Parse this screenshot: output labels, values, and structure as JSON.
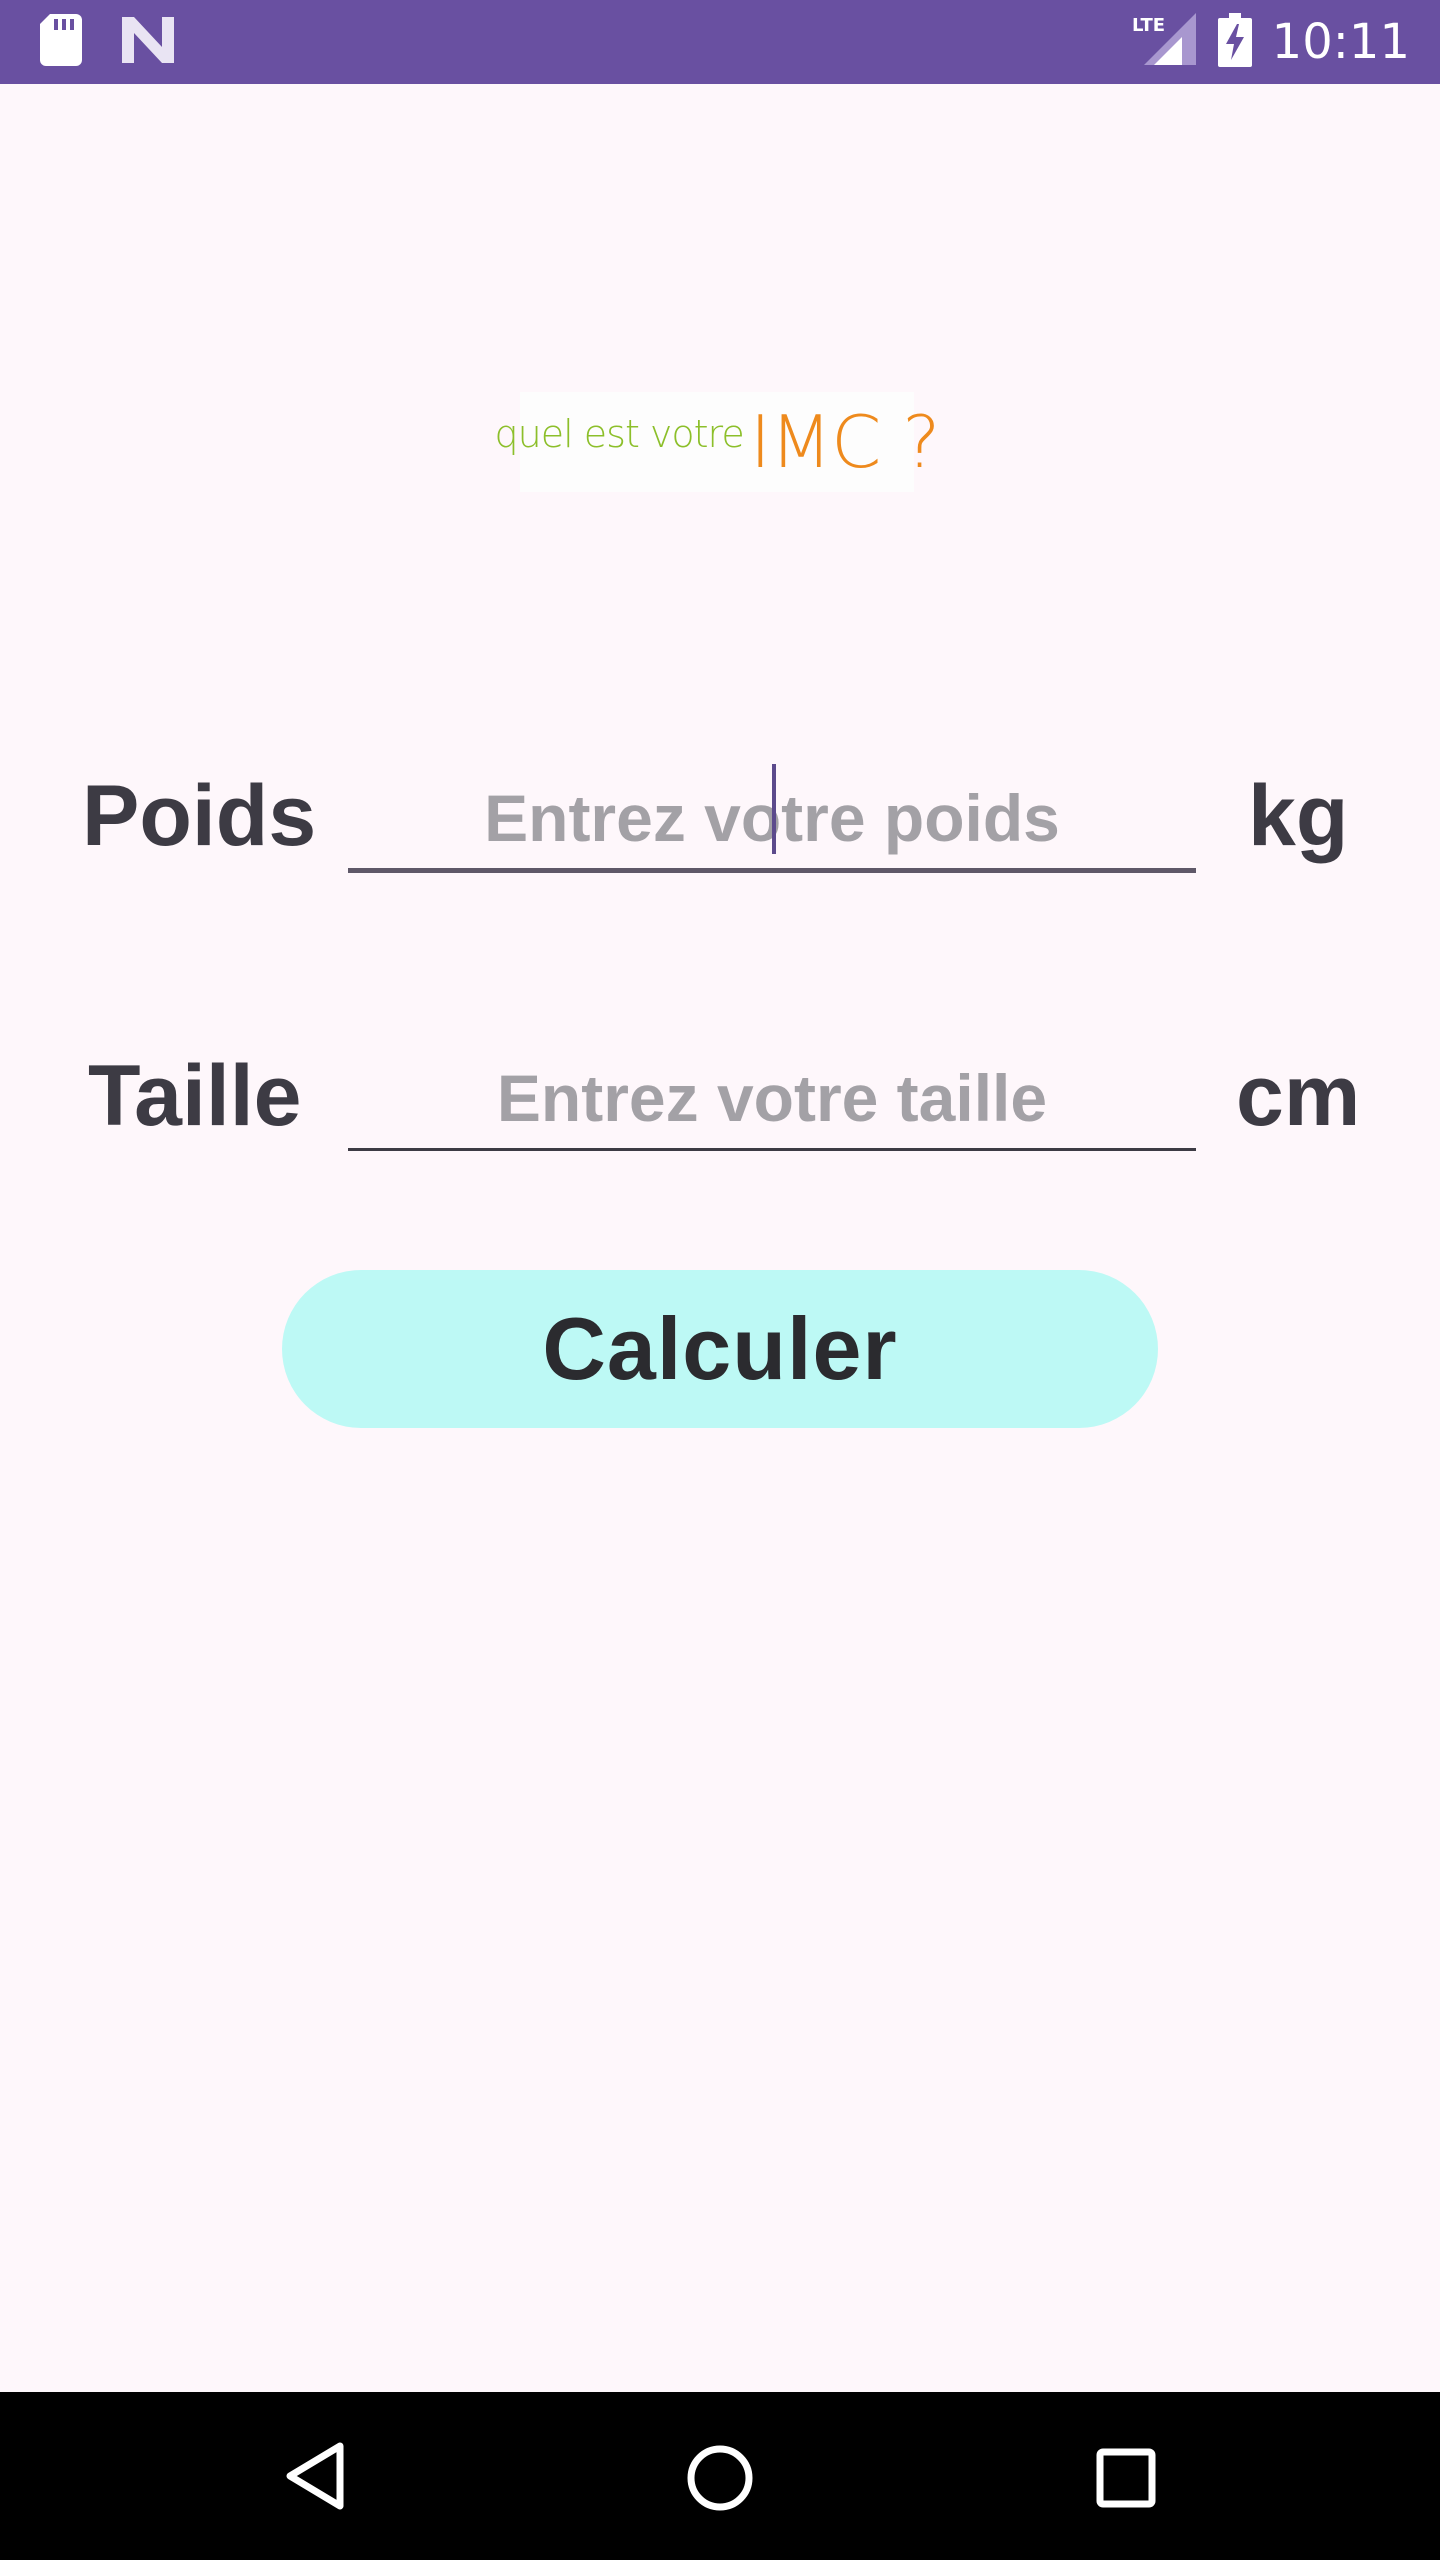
{
  "status_bar": {
    "time": "10:11",
    "network": "LTE",
    "background_color": "#6950a1",
    "icons": [
      "sd-card-icon",
      "n-logo-icon",
      "lte-signal-icon",
      "battery-charging-icon"
    ]
  },
  "logo": {
    "small_text": "quel est votre",
    "big_text": "IMC ?"
  },
  "form": {
    "weight": {
      "label": "Poids",
      "placeholder": "Entrez votre poids",
      "value": "",
      "unit": "kg",
      "focused": true
    },
    "height": {
      "label": "Taille",
      "placeholder": "Entrez votre taille",
      "value": "",
      "unit": "cm"
    },
    "submit_label": "Calculer",
    "button_color": "#bdf9f5"
  },
  "nav_bar": {
    "icons": [
      "back-icon",
      "home-icon",
      "recents-icon"
    ]
  }
}
